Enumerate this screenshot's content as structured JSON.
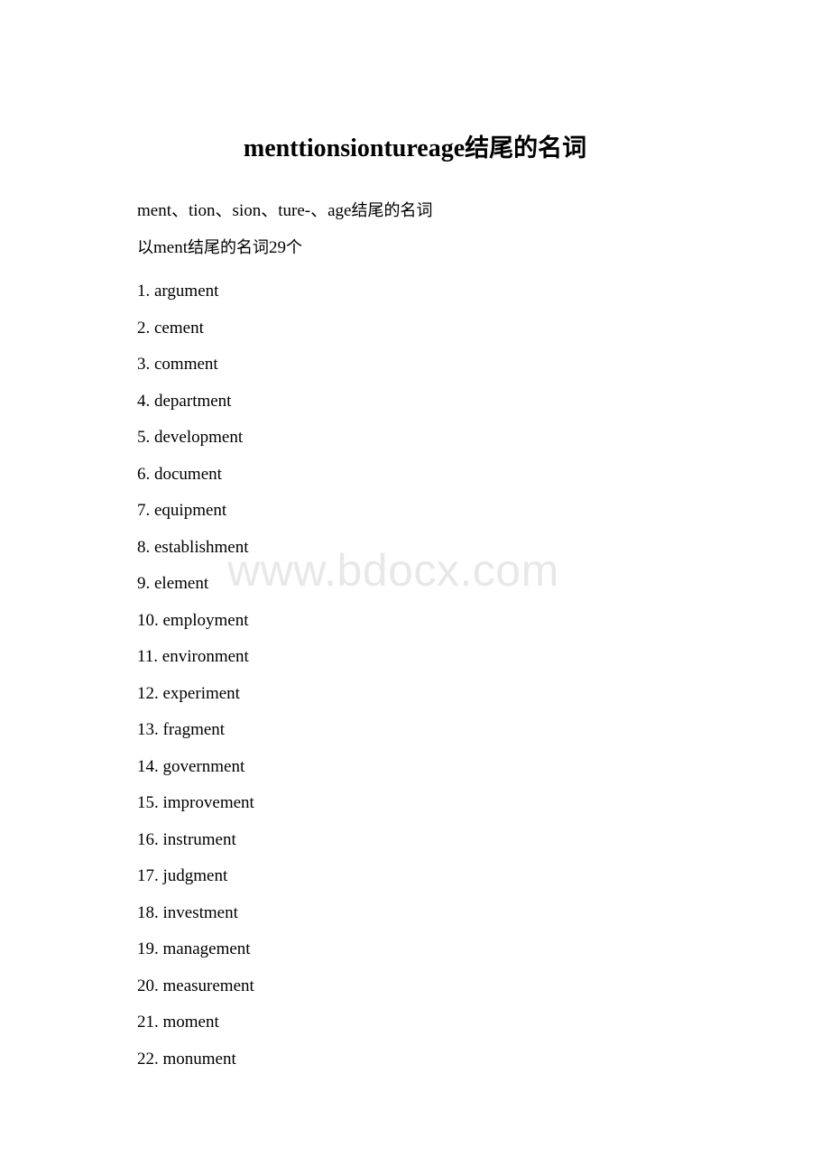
{
  "document": {
    "title_latin": "menttionsiontureage",
    "title_cn": "结尾的名词",
    "intro_latin": "ment、tion、sion、ture-、age",
    "intro_cn": "结尾的名词",
    "count_prefix_cn": "以",
    "count_latin": "ment",
    "count_middle_cn": "结尾的名词",
    "count_number": "29",
    "count_suffix_cn": "个",
    "watermark": "www.bdocx.com",
    "background_color": "#ffffff",
    "text_color": "#000000",
    "watermark_color": "#e8e8e8"
  },
  "list": {
    "items": [
      {
        "num": "1.",
        "term": "argument"
      },
      {
        "num": "2.",
        "term": "cement"
      },
      {
        "num": "3.",
        "term": "comment"
      },
      {
        "num": "4.",
        "term": "department"
      },
      {
        "num": "5.",
        "term": "development"
      },
      {
        "num": "6.",
        "term": "document"
      },
      {
        "num": "7.",
        "term": "equipment"
      },
      {
        "num": "8.",
        "term": "establishment"
      },
      {
        "num": "9.",
        "term": "element"
      },
      {
        "num": "10.",
        "term": "employment"
      },
      {
        "num": "11.",
        "term": "environment"
      },
      {
        "num": "12.",
        "term": "experiment"
      },
      {
        "num": "13.",
        "term": "fragment"
      },
      {
        "num": "14.",
        "term": "government"
      },
      {
        "num": "15.",
        "term": "improvement"
      },
      {
        "num": "16.",
        "term": "instrument"
      },
      {
        "num": "17.",
        "term": "judgment"
      },
      {
        "num": "18.",
        "term": "investment"
      },
      {
        "num": "19.",
        "term": "management"
      },
      {
        "num": "20.",
        "term": "measurement"
      },
      {
        "num": "21.",
        "term": "moment"
      },
      {
        "num": "22.",
        "term": "monument"
      }
    ]
  }
}
